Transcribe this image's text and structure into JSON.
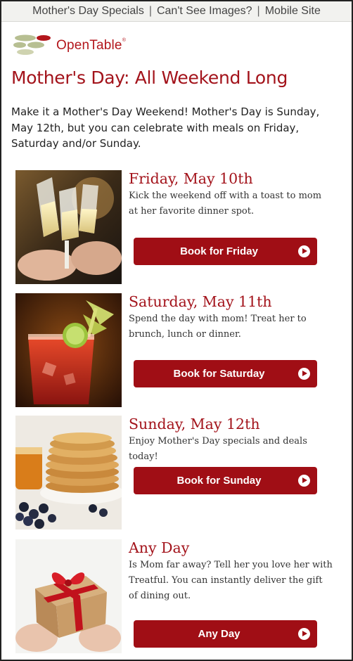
{
  "topbar": {
    "links": [
      "Mother's Day Specials",
      "Can't See Images?",
      "Mobile Site"
    ],
    "separator": "|"
  },
  "logo": {
    "text": "OpenTable",
    "mark": "®"
  },
  "headline": "Mother's Day: All Weekend Long",
  "intro": "Make it a Mother's Day Weekend! Mother's Day is Sunday, May 12th, but you can celebrate with meals on Friday, Saturday and/or Sunday.",
  "days": [
    {
      "title": "Friday, May 10th",
      "desc": "Kick the weekend off with a toast to mom at her favorite dinner spot.",
      "button": "Book for Friday",
      "image": "champagne-toast-photo"
    },
    {
      "title": "Saturday, May 11th",
      "desc": "Spend the day with mom! Treat her to brunch, lunch or dinner.",
      "button": "Book for Saturday",
      "image": "cocktail-photo"
    },
    {
      "title": "Sunday, May 12th",
      "desc": "Enjoy Mother's Day specials and deals today!",
      "button": "Book for Sunday",
      "image": "pancakes-photo"
    },
    {
      "title": "Any Day",
      "desc": "Is Mom far away? Tell her you love her with Treatful. You can instantly deliver the gift of dining out.",
      "button": "Any Day",
      "image": "gift-box-photo"
    }
  ],
  "colors": {
    "brand_red": "#a00e15",
    "headline_red": "#a3131b",
    "topbar_bg": "#f2f2ef"
  }
}
